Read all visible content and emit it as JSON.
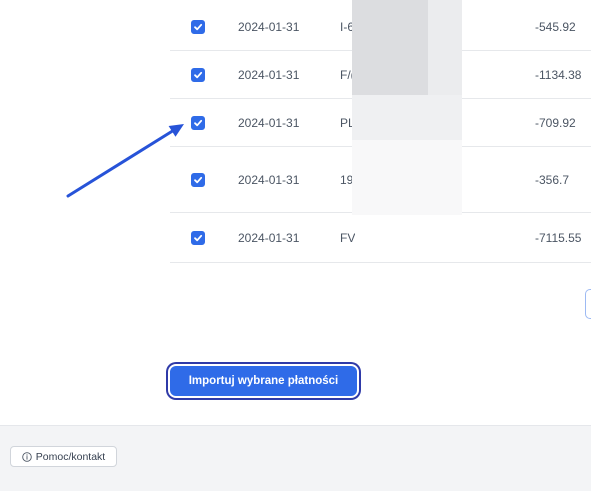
{
  "table": {
    "rows": [
      {
        "checked": "true",
        "date": "2024-01-31",
        "description": "I-6",
        "amount": "-545.92"
      },
      {
        "checked": "true",
        "date": "2024-01-31",
        "description": "F/(",
        "amount": "-1134.38"
      },
      {
        "checked": "true",
        "date": "2024-01-31",
        "description": "PL",
        "amount": "-709.92"
      },
      {
        "checked": "true",
        "date": "2024-01-31",
        "description": "19",
        "amount": "-356.7"
      },
      {
        "checked": "true",
        "date": "2024-01-31",
        "description": "FV",
        "amount": "-7115.55"
      }
    ]
  },
  "import_button": {
    "label": "Importuj wybrane płatności"
  },
  "footer": {
    "help_label": "Pomoc/kontakt"
  },
  "icons": {
    "checkbox_mark": "check-icon",
    "help": "info-icon",
    "annotation": "arrow-icon"
  },
  "colors": {
    "accent": "#2f6be8",
    "focus_ring": "#2f3aa8",
    "arrow": "#2753d8",
    "footer_bg": "#f3f4f6"
  }
}
